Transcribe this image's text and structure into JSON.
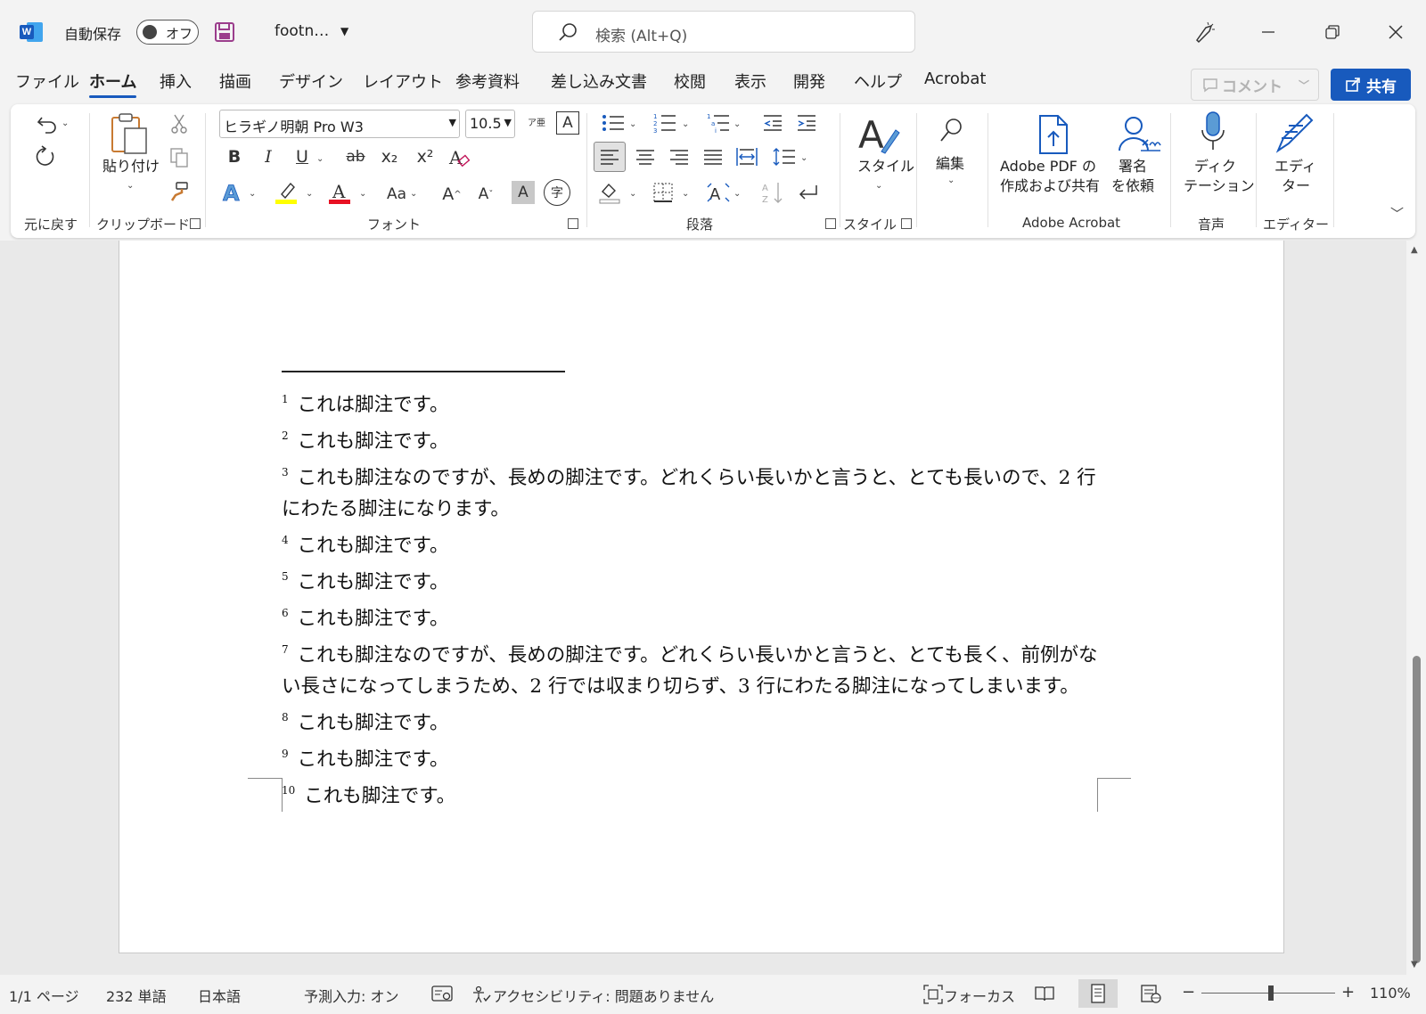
{
  "titlebar": {
    "autosave_label": "自動保存",
    "autosave_state": "オフ",
    "filename": "footn…",
    "search_placeholder": "検索 (Alt+Q)"
  },
  "tabs": [
    "ファイル",
    "ホーム",
    "挿入",
    "描画",
    "デザイン",
    "レイアウト",
    "参考資料",
    "差し込み文書",
    "校閲",
    "表示",
    "開発",
    "ヘルプ",
    "Acrobat"
  ],
  "active_tab": "ホーム",
  "actions": {
    "comment": "コメント",
    "share": "共有"
  },
  "ribbon": {
    "undo_group": "元に戻す",
    "clipboard": {
      "paste": "貼り付け",
      "group": "クリップボード"
    },
    "font": {
      "name": "ヒラギノ明朝 Pro W3",
      "size": "10.5",
      "group": "フォント",
      "ruby": "ア亜",
      "clear": "A",
      "bold": "B",
      "italic": "I",
      "underline": "U",
      "strike": "ab",
      "sub": "x₂",
      "sup": "x²",
      "case": "Aa",
      "grow": "A",
      "shrink": "A",
      "shade": "A",
      "enclose": "字"
    },
    "paragraph": {
      "group": "段落"
    },
    "styles": {
      "label": "スタイル",
      "group": "スタイル"
    },
    "editing": {
      "label": "編集"
    },
    "acrobat": {
      "create_pdf_line1": "Adobe PDF の",
      "create_pdf_line2": "作成および共有",
      "sign_line1": "署名",
      "sign_line2": "を依頼",
      "group": "Adobe Acrobat"
    },
    "voice": {
      "dictate_line1": "ディク",
      "dictate_line2": "テーション",
      "group": "音声"
    },
    "editor": {
      "label_line1": "エディ",
      "label_line2": "ター",
      "group": "エディター"
    }
  },
  "document": {
    "footnotes": [
      {
        "num": "1",
        "text": "これは脚注です。"
      },
      {
        "num": "2",
        "text": "これも脚注です。"
      },
      {
        "num": "3",
        "text": "これも脚注なのですが、長めの脚注です。どれくらい長いかと言うと、とても長いので、2 行にわたる脚注になります。"
      },
      {
        "num": "4",
        "text": "これも脚注です。"
      },
      {
        "num": "5",
        "text": "これも脚注です。"
      },
      {
        "num": "6",
        "text": "これも脚注です。"
      },
      {
        "num": "7",
        "text": "これも脚注なのですが、長めの脚注です。どれくらい長いかと言うと、とても長く、前例がない長さになってしまうため、2 行では収まり切らず、3 行にわたる脚注になってしまいます。"
      },
      {
        "num": "8",
        "text": "これも脚注です。"
      },
      {
        "num": "9",
        "text": "これも脚注です。"
      },
      {
        "num": "10",
        "text": "これも脚注です。"
      }
    ]
  },
  "statusbar": {
    "page": "1/1 ページ",
    "words": "232 単語",
    "language": "日本語",
    "predict": "予測入力: オン",
    "accessibility": "アクセシビリティ: 問題ありません",
    "focus": "フォーカス",
    "zoom": "110%"
  },
  "colors": {
    "accent": "#185abd",
    "highlight": "#ffff00",
    "font_color": "#e81123"
  }
}
